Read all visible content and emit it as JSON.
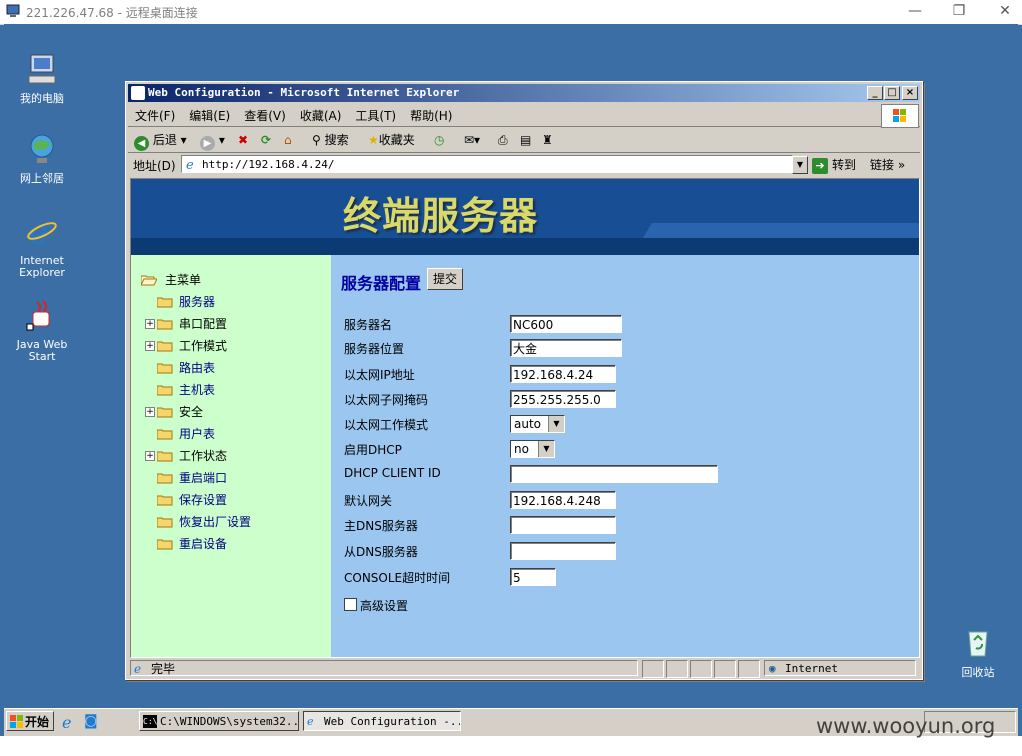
{
  "rdp": {
    "title": "221.226.47.68 - 远程桌面连接",
    "controls": [
      "—",
      "❐",
      "✕"
    ]
  },
  "desktop": {
    "icons": [
      {
        "label": "我的电脑",
        "icon": "my-computer-icon"
      },
      {
        "label": "网上邻居",
        "icon": "network-places-icon"
      },
      {
        "label_line1": "Internet",
        "label_line2": "Explorer",
        "icon": "internet-explorer-icon"
      },
      {
        "label_line1": "Java Web",
        "label_line2": "Start",
        "icon": "java-web-start-icon"
      },
      {
        "label": "回收站",
        "icon": "recycle-bin-icon"
      }
    ]
  },
  "ie": {
    "title": "Web Configuration - Microsoft Internet Explorer",
    "menu": [
      "文件(F)",
      "编辑(E)",
      "查看(V)",
      "收藏(A)",
      "工具(T)",
      "帮助(H)"
    ],
    "toolbar": {
      "back": "后退",
      "search": "搜索",
      "favorites": "收藏夹"
    },
    "address": {
      "label": "地址(D)",
      "value": "http://192.168.4.24/",
      "go": "转到",
      "links": "链接 »"
    },
    "status": {
      "text": "完毕",
      "zone": "Internet"
    }
  },
  "page": {
    "banner_title": "终端服务器",
    "nav": {
      "root": "主菜单",
      "items": [
        {
          "label": "服务器",
          "expandable": false,
          "link": true
        },
        {
          "label": "串口配置",
          "expandable": true,
          "link": false
        },
        {
          "label": "工作模式",
          "expandable": true,
          "link": false
        },
        {
          "label": "路由表",
          "expandable": false,
          "link": true
        },
        {
          "label": "主机表",
          "expandable": false,
          "link": true
        },
        {
          "label": "安全",
          "expandable": true,
          "link": false
        },
        {
          "label": "用户表",
          "expandable": false,
          "link": true
        },
        {
          "label": "工作状态",
          "expandable": true,
          "link": false
        },
        {
          "label": "重启端口",
          "expandable": false,
          "link": true
        },
        {
          "label": "保存设置",
          "expandable": false,
          "link": true
        },
        {
          "label": "恢复出厂设置",
          "expandable": false,
          "link": true
        },
        {
          "label": "重启设备",
          "expandable": false,
          "link": true
        }
      ]
    },
    "form": {
      "title": "服务器配置",
      "submit": "提交",
      "fields": [
        {
          "label": "服务器名",
          "value": "NC600"
        },
        {
          "label": "服务器位置",
          "value": "大金"
        },
        {
          "label": "以太网IP地址",
          "value": "192.168.4.24"
        },
        {
          "label": "以太网子网掩码",
          "value": "255.255.255.0"
        },
        {
          "label": "以太网工作模式",
          "value": "auto"
        },
        {
          "label": "启用DHCP",
          "value": "no"
        },
        {
          "label": "DHCP CLIENT ID",
          "value": ""
        },
        {
          "label": "默认网关",
          "value": "192.168.4.248"
        },
        {
          "label": "主DNS服务器",
          "value": ""
        },
        {
          "label": "从DNS服务器",
          "value": ""
        },
        {
          "label": "CONSOLE超时时间",
          "value": "5"
        }
      ],
      "advanced": "高级设置"
    }
  },
  "taskbar": {
    "start": "开始",
    "tasks": [
      "C:\\WINDOWS\\system32...",
      "Web Configuration -..."
    ]
  },
  "watermark": "www.wooyun.org",
  "colors": {
    "desktop": "#3a6ea5",
    "banner": "#184f94",
    "nav_bg": "#ccffcc",
    "content_bg": "#9ac6ef",
    "title_blue": "#0000a0"
  }
}
